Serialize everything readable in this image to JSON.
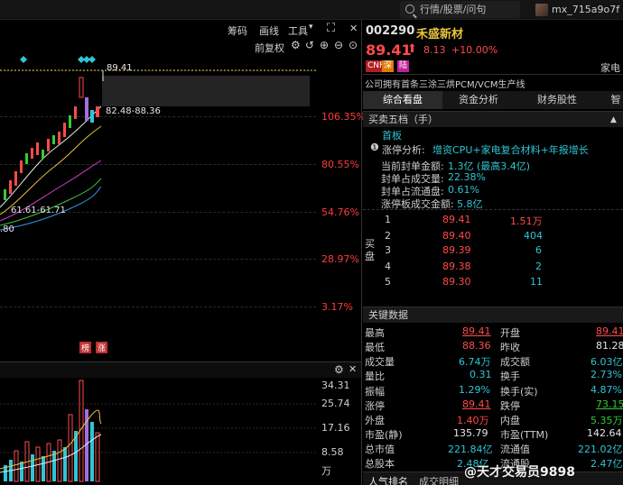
{
  "topbar": {
    "search_placeholder": "行情/股票/问句",
    "username": "mx_715a9o7f"
  },
  "chart_toolbar": {
    "items": [
      "筹码",
      "画线",
      "工具"
    ],
    "fuquan": "前复权"
  },
  "chart": {
    "high_label": "89.41",
    "range_label": "82.48-88.36",
    "low_label": "61.61-61.71",
    "left_label": ".80",
    "badges": [
      "榜",
      "涨"
    ],
    "pct_axis": [
      "106.35%",
      "80.55%",
      "54.76%",
      "28.97%",
      "3.17%"
    ],
    "vol_axis": [
      "34.31",
      "25.74",
      "17.16",
      "8.58",
      "万"
    ]
  },
  "stock": {
    "code": "002290",
    "name": "禾盛新材",
    "price": "89.41",
    "change": "8.13",
    "change_pct": "+10.00%",
    "tags": [
      "CNF",
      "深",
      "陆"
    ],
    "right_label": "家电",
    "description": "公司拥有首条三涂三烘PCM/VCM生产线"
  },
  "tabs": [
    "综合看盘",
    "资金分析",
    "财务股性",
    "智"
  ],
  "order_section": {
    "title": "买卖五档（手）",
    "board": "首板",
    "analysis_label": "涨停分析:",
    "analysis_value": "增资CPU+家电复合材料+年报增长",
    "lines": [
      {
        "label": "当前封单金额:",
        "value": "1.3亿 (最高3.4亿)"
      },
      {
        "label": "封单占成交量:",
        "value": "22.38%"
      },
      {
        "label": "封单占流通盘:",
        "value": "0.61%"
      },
      {
        "label": "涨停板成交金额:",
        "value": "5.8亿"
      }
    ],
    "side_label": "买盘",
    "bids": [
      {
        "level": "1",
        "price": "89.41",
        "volume": "1.51万"
      },
      {
        "level": "2",
        "price": "89.40",
        "volume": "404"
      },
      {
        "level": "3",
        "price": "89.39",
        "volume": "6"
      },
      {
        "level": "4",
        "price": "89.38",
        "volume": "2"
      },
      {
        "level": "5",
        "price": "89.30",
        "volume": "11"
      }
    ]
  },
  "key_data": {
    "title": "关键数据",
    "rows": [
      {
        "l1": "最高",
        "v1": "89.41",
        "c1": "red",
        "l2": "开盘",
        "v2": "89.41",
        "c2": "red"
      },
      {
        "l1": "最低",
        "v1": "88.36",
        "c1": "red",
        "l2": "昨收",
        "v2": "81.28",
        "c2": "white"
      },
      {
        "l1": "成交量",
        "v1": "6.74万",
        "c1": "cyan",
        "l2": "成交额",
        "v2": "6.03亿",
        "c2": "cyan"
      },
      {
        "l1": "量比",
        "v1": "0.31",
        "c1": "cyan",
        "l2": "换手",
        "v2": "2.73%",
        "c2": "cyan"
      },
      {
        "l1": "振幅",
        "v1": "1.29%",
        "c1": "cyan",
        "l2": "换手(实)",
        "v2": "4.87%",
        "c2": "cyan"
      },
      {
        "l1": "涨停",
        "v1": "89.41",
        "c1": "red",
        "l2": "跌停",
        "v2": "73.15",
        "c2": "green"
      },
      {
        "l1": "外盘",
        "v1": "1.40万",
        "c1": "red",
        "l2": "内盘",
        "v2": "5.35万",
        "c2": "green"
      },
      {
        "l1": "市盈(静)",
        "v1": "135.79",
        "c1": "white",
        "l2": "市盈(TTM)",
        "v2": "142.64",
        "c2": "white"
      },
      {
        "l1": "总市值",
        "v1": "221.84亿",
        "c1": "cyan",
        "l2": "流通值",
        "v2": "221.02亿",
        "c2": "cyan"
      },
      {
        "l1": "总股本",
        "v1": "2.48亿",
        "c1": "cyan",
        "l2": "流通股",
        "v2": "2.47亿",
        "c2": "cyan"
      }
    ]
  },
  "bottom_tabs": [
    "人气排名",
    "成交明细"
  ],
  "watermark": "@天才交易员9898",
  "colors": {
    "up": "#ff4a4a",
    "down": "#33cc33",
    "cyan": "#2ec5d5",
    "accent": "#e8c33c"
  }
}
